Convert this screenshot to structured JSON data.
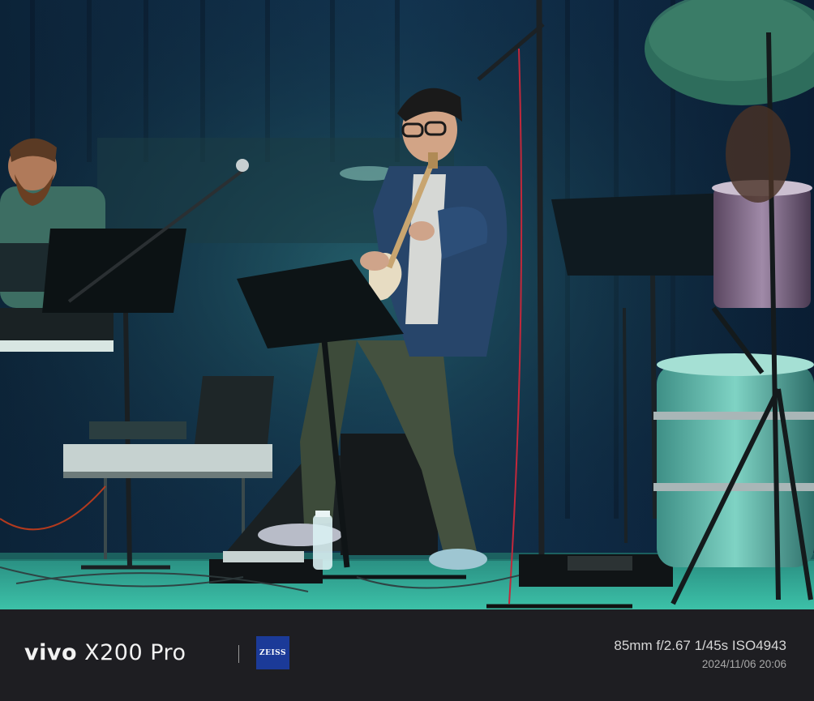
{
  "photo": {
    "description_icon": "concert-photo"
  },
  "watermark": {
    "brand_prefix": "vivo",
    "model": "X200 Pro",
    "lens_logo_text": "ZEISS",
    "exif": "85mm  f/2.67  1/45s  ISO4943",
    "datetime": "2024/11/06 20:06"
  },
  "colors": {
    "footer_bg": "#1e1e22",
    "zeiss_blue": "#1b3a98",
    "stage_teal": "#2fae9c"
  }
}
